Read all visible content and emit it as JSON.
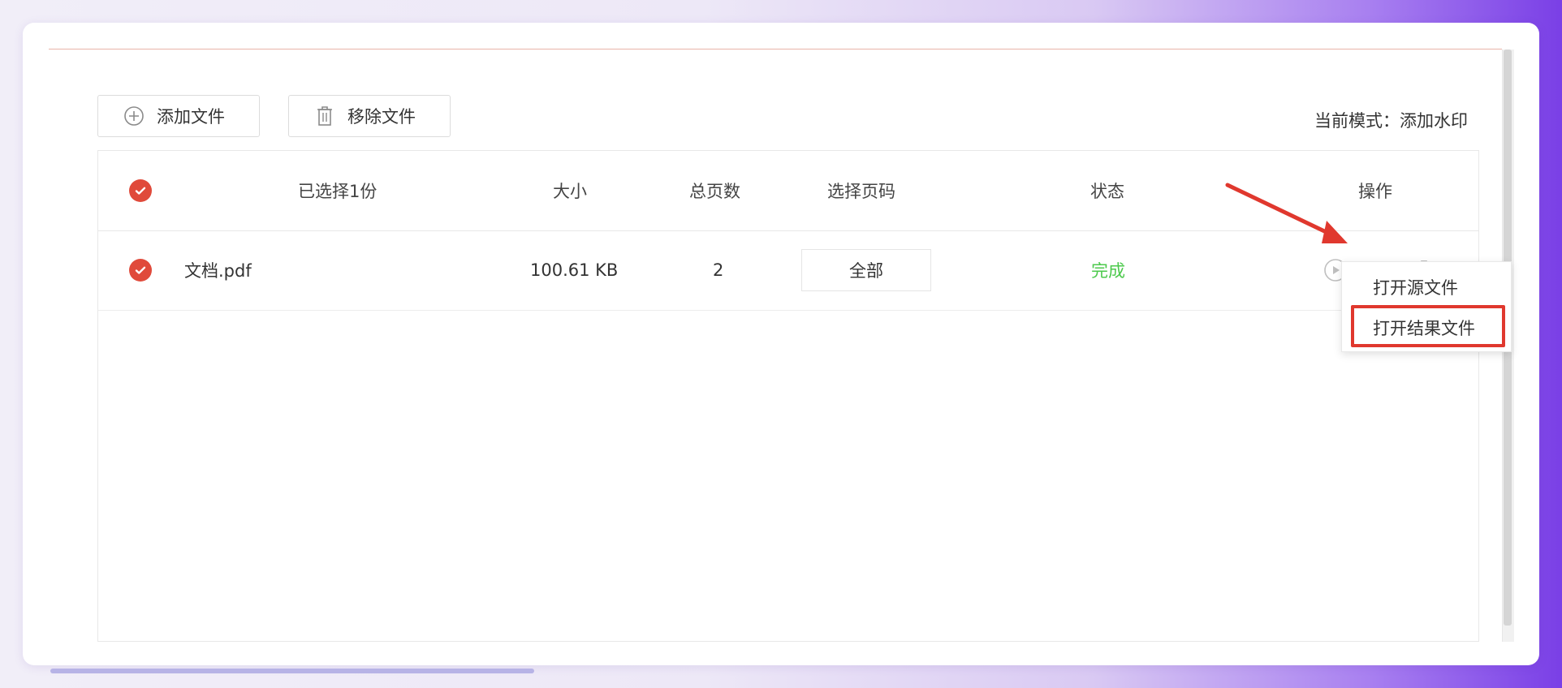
{
  "toolbar": {
    "add_label": "添加文件",
    "remove_label": "移除文件",
    "mode_text": "当前模式：添加水印"
  },
  "table": {
    "headers": {
      "selected": "已选择1份",
      "size": "大小",
      "pages": "总页数",
      "page_select": "选择页码",
      "status": "状态",
      "actions": "操作"
    },
    "rows": [
      {
        "name": "文档.pdf",
        "size": "100.61 KB",
        "pages": "2",
        "page_select": "全部",
        "status": "完成"
      }
    ]
  },
  "dropdown": {
    "items": [
      "打开源文件",
      "打开结果文件"
    ]
  },
  "icons": {
    "add": "plus-circle-icon",
    "remove": "trash-icon",
    "play": "play-circle-icon",
    "folder": "folder-icon",
    "delete": "trash-icon"
  },
  "colors": {
    "accent_red": "#e04a3b",
    "status_green": "#4cc94c",
    "highlight_red": "#e0382e"
  }
}
